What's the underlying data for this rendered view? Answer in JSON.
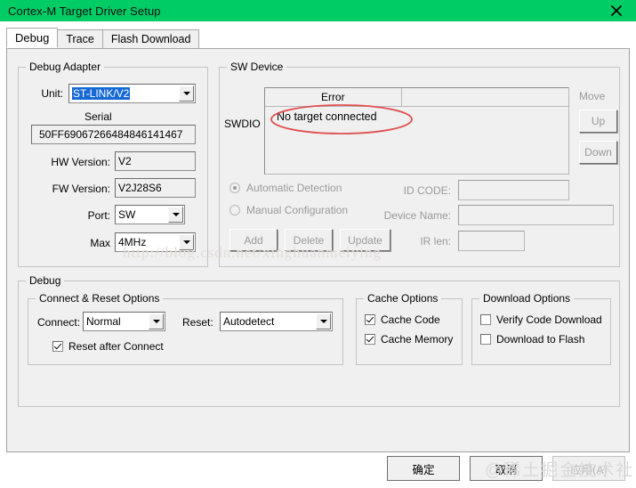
{
  "window": {
    "title": "Cortex-M Target Driver Setup",
    "close_icon": "close-icon"
  },
  "tabs": [
    {
      "label": "Debug",
      "active": true
    },
    {
      "label": "Trace",
      "active": false
    },
    {
      "label": "Flash Download",
      "active": false
    }
  ],
  "debug_adapter": {
    "legend": "Debug Adapter",
    "unit_label": "Unit:",
    "unit_value": "ST-LINK/V2",
    "serial_label": "Serial",
    "serial_value": "50FF69067266484846141467",
    "hw_version_label": "HW Version:",
    "hw_version_value": "V2",
    "fw_version_label": "FW Version:",
    "fw_version_value": "V2J28S6",
    "port_label": "Port:",
    "port_value": "SW",
    "max_label": "Max",
    "max_value": "4MHz"
  },
  "sw_device": {
    "legend": "SW Device",
    "swdio_label": "SWDIO",
    "columns": [
      "Error",
      ""
    ],
    "rows": [
      {
        "error": "No target connected"
      }
    ],
    "move_label": "Move",
    "up_label": "Up",
    "down_label": "Down",
    "automatic_detection_label": "Automatic Detection",
    "manual_configuration_label": "Manual Configuration",
    "detection_mode": "automatic",
    "id_code_label": "ID CODE:",
    "id_code_value": "",
    "device_name_label": "Device Name:",
    "device_name_value": "",
    "ir_len_label": "IR len:",
    "ir_len_value": "",
    "add_label": "Add",
    "delete_label": "Delete",
    "update_label": "Update"
  },
  "debug_group": {
    "legend": "Debug",
    "connect_reset": {
      "legend": "Connect & Reset Options",
      "connect_label": "Connect:",
      "connect_value": "Normal",
      "reset_label": "Reset:",
      "reset_value": "Autodetect",
      "reset_after_connect_label": "Reset after Connect",
      "reset_after_connect_checked": true
    },
    "cache_options": {
      "legend": "Cache Options",
      "cache_code_label": "Cache Code",
      "cache_code_checked": true,
      "cache_memory_label": "Cache Memory",
      "cache_memory_checked": true
    },
    "download_options": {
      "legend": "Download Options",
      "verify_code_download_label": "Verify Code Download",
      "verify_code_download_checked": false,
      "download_to_flash_label": "Download to Flash",
      "download_to_flash_checked": false
    }
  },
  "footer": {
    "ok_label": "确定",
    "cancel_label": "取消",
    "apply_label": "应用(A)"
  },
  "watermarks": {
    "url": "http://blog.csdn.net/xinghuanmeiying",
    "cn": "@稀土掘金技术社区"
  },
  "colors": {
    "titlebar": "#00cc66",
    "dialog_face": "#f0f0f0",
    "selection": "#1669d4",
    "annotation": "#e05050"
  }
}
